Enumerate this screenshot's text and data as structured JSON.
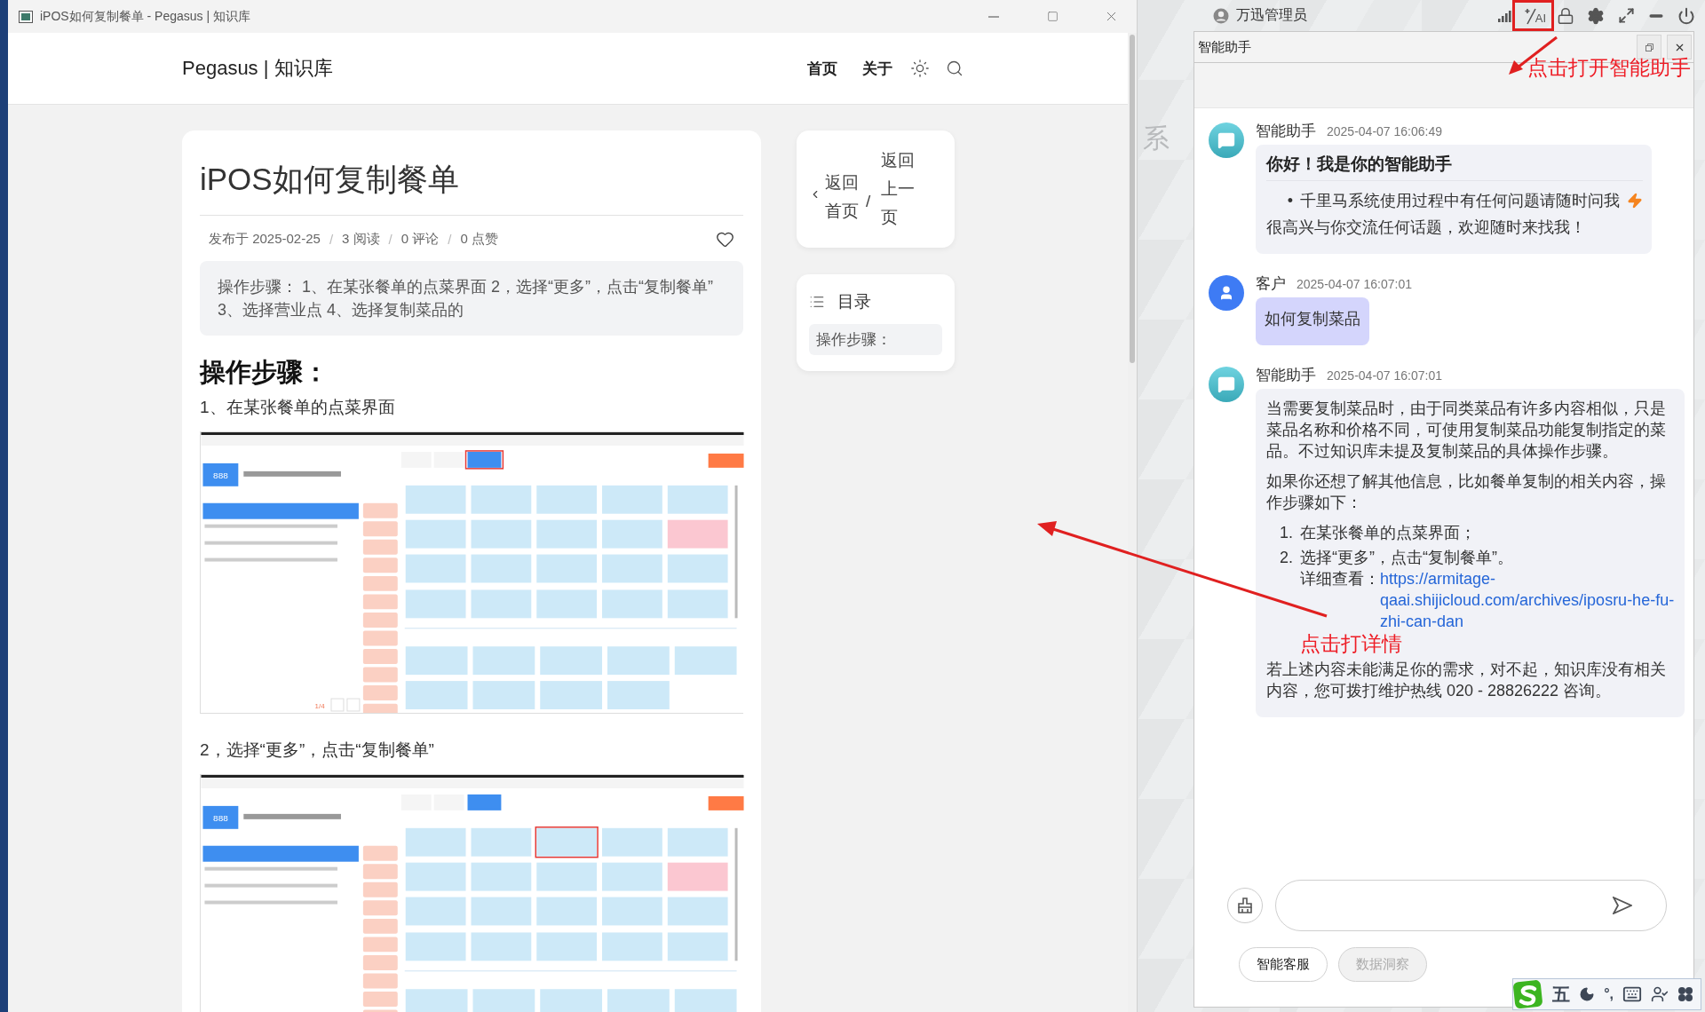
{
  "browser": {
    "title": "iPOS如何复制餐单 - Pegasus | 知识库"
  },
  "site": {
    "brand": "Pegasus | 知识库",
    "nav": [
      {
        "label": "首页"
      },
      {
        "label": "关于"
      }
    ]
  },
  "article": {
    "title": "iPOS如何复制餐单",
    "meta": [
      {
        "text": "发布于 2025-02-25"
      },
      {
        "separator": "/",
        "text": "3 阅读"
      },
      {
        "separator": "/",
        "text": "0 评论"
      },
      {
        "separator": "/",
        "text": "0 点赞"
      }
    ],
    "liked": false,
    "summary": "操作步骤： 1、在某张餐单的点菜界面 2，选择“更多”，点击“复制餐单” 3、选择营业点 4、选择复制菜品的",
    "heading": "操作步骤：",
    "steps": [
      {
        "text": "1、在某张餐单的点菜界面",
        "screenshot": {
          "badge": "888",
          "page": "1/4",
          "kind": "tab"
        }
      },
      {
        "text": "2，选择“更多”，点击“复制餐单”",
        "screenshot": {
          "badge": "888",
          "kind": "tile"
        }
      }
    ]
  },
  "sidebar": {
    "back": {
      "home": "返回首页",
      "separator": "/",
      "previous": "返回上一页"
    },
    "toc": {
      "title": "目录",
      "items": [
        {
          "label": "操作步骤：",
          "selected": true
        }
      ]
    }
  },
  "desktop": {
    "background_text": "系",
    "user": "万迅管理员",
    "ai_button": "AI"
  },
  "assistant": {
    "title": "智能助手",
    "messages": [
      {
        "kind": "bot",
        "sender": "智能助手",
        "time": "2025-04-07 16:06:49",
        "blocks": [
          {
            "kind": "heading",
            "text": "你好！我是你的智能助手"
          },
          {
            "kind": "bullets",
            "items": [
              {
                "marker": "•",
                "text": "千里马系统使用过程中有任何问题请随时问我"
              }
            ]
          },
          {
            "kind": "p",
            "text": "很高兴与你交流任何话题，欢迎随时来找我！"
          }
        ]
      },
      {
        "kind": "user",
        "sender": "客户",
        "time": "2025-04-07 16:07:01",
        "blocks": [
          {
            "kind": "p",
            "text": "如何复制菜品"
          }
        ]
      },
      {
        "kind": "bot",
        "sender": "智能助手",
        "time": "2025-04-07 16:07:01",
        "blocks": [
          {
            "kind": "p",
            "text": "当需要复制菜品时，由于同类菜品有许多内容相似，只是菜品名称和价格不同，可使用复制菜品功能复制指定的菜品。不过知识库未提及复制菜品的具体操作步骤。"
          },
          {
            "kind": "p",
            "text": "如果你还想了解其他信息，比如餐单复制的相关内容，操作步骤如下："
          },
          {
            "kind": "ol",
            "items": [
              {
                "number": "1.",
                "text": "在某张餐单的点菜界面；"
              },
              {
                "number": "2.",
                "text": "选择“更多”，点击“复制餐单”。",
                "detail": "详细查看：",
                "link": "https://armitage-qaai.shijicloud.com/archives/iposru-he-fu-zhi-can-dan"
              }
            ]
          },
          {
            "kind": "p",
            "text": "若上述内容未能满足你的需求，对不起，知识库没有相关内容，您可拨打维护热线 020 - 28826222 咨询。"
          }
        ]
      }
    ],
    "mode_buttons": [
      {
        "label": "智能客服",
        "disabled": false
      },
      {
        "label": "数据洞察",
        "disabled": true
      }
    ]
  },
  "annotations": [
    {
      "kind": "top",
      "text": "点击打开智能助手"
    },
    {
      "kind": "link",
      "text": "点击打详情"
    }
  ],
  "ime_bar": {
    "mode": "五",
    "punctuation": "°,"
  }
}
